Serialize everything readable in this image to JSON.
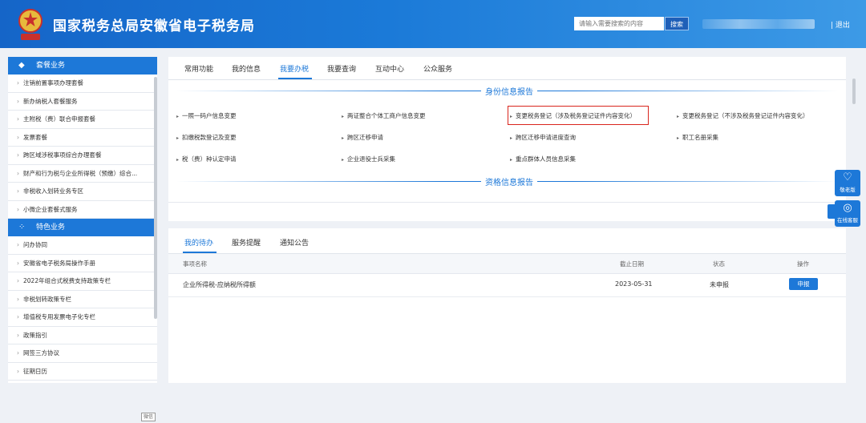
{
  "header": {
    "title": "国家税务总局安徽省电子税务局",
    "search_placeholder": "请输入需要搜索的内容",
    "search_button": "搜索",
    "logout": "| 退出"
  },
  "sidebar": {
    "section1": {
      "label": "套餐业务",
      "icon": "layers-icon"
    },
    "items1": [
      "注销前置事项办理套餐",
      "新办纳税人套餐服务",
      "主附税（费）联合申报套餐",
      "发票套餐",
      "跨区域涉税事项综合办理套餐",
      "财产和行为税与企业所得税（预缴）综合...",
      "非税收入划转业务专区",
      "小微企业套餐式服务"
    ],
    "section2": {
      "label": "特色业务",
      "icon": "grid-icon"
    },
    "items2": [
      "问办协同",
      "安徽省电子税务局操作手册",
      "2022年组合式税费支持政策专栏",
      "非税划转政策专栏",
      "增值税专用发票电子化专栏",
      "政策指引",
      "网签三方协议",
      "征期日历"
    ]
  },
  "tabs": [
    "常用功能",
    "我的信息",
    "我要办税",
    "我要查询",
    "互动中心",
    "公众服务"
  ],
  "active_tab": "我要办税",
  "sections": {
    "identity": "身份信息报告",
    "qualification": "资格信息报告"
  },
  "links": [
    "一照一码户信息变更",
    "两证整合个体工商户信息变更",
    "变更税务登记（涉及税务登记证件内容变化）",
    "变更税务登记（不涉及税务登记证件内容变化）",
    "扣缴税款登记及变更",
    "跨区迁移申请",
    "跨区迁移申请进度查询",
    "职工名册采集",
    "税（费）种认定申请",
    "企业退役士兵采集",
    "重点群体人员信息采集"
  ],
  "float_buttons": {
    "elder": "敬老版",
    "service": "在线客服"
  },
  "todo": {
    "tabs": [
      "我的待办",
      "服务提醒",
      "通知公告"
    ],
    "headers": {
      "name": "事项名称",
      "deadline": "截止日期",
      "status": "状态",
      "action": "操作"
    },
    "rows": [
      {
        "name": "企业所得税-应纳税所得额",
        "deadline": "2023-05-31",
        "status": "未申报",
        "action": "申报"
      }
    ]
  },
  "watermark": "微信",
  "colors": {
    "primary": "#1d78d8",
    "highlight": "#d9251d"
  }
}
